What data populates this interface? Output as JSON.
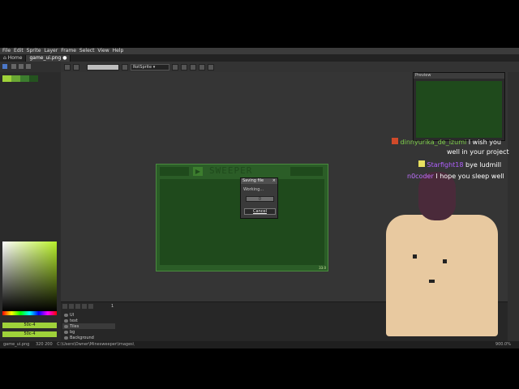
{
  "menu": [
    "File",
    "Edit",
    "Sprite",
    "Layer",
    "Frame",
    "Select",
    "View",
    "Help"
  ],
  "tabs": [
    {
      "label": "Home"
    },
    {
      "label": "game_ui.png",
      "active": true
    }
  ],
  "context_bar": {
    "mode_value": "RotSprite"
  },
  "preview": {
    "title": "Preview"
  },
  "sprite": {
    "title_text": "SWEEPER",
    "zoom_badge": "33.0"
  },
  "dialog": {
    "title": "Saving file",
    "status": "Working...",
    "progress_label": "0",
    "progress": 0,
    "cancel_label": "Cancel"
  },
  "color_fields": {
    "fg": "50c-4",
    "bg": "50c-4"
  },
  "layers": [
    {
      "name": "UI"
    },
    {
      "name": "text"
    },
    {
      "name": "Tiles"
    },
    {
      "name": "bg"
    },
    {
      "name": "Background"
    }
  ],
  "frame_number": "1",
  "status": {
    "file": "game_ui.png",
    "size": "320 200",
    "path": "C:\\Users\\Owner\\Minesweeper\\images\\",
    "zoom": "900.0%"
  },
  "chat": [
    {
      "user": "dinnyurika_de_izumi",
      "user_color": "#7fd14a",
      "message": "I wish you",
      "badge": "#d04a2a"
    },
    {
      "user": "",
      "user_color": "#ffffff",
      "message": "well in your project"
    },
    {
      "user": "Starfight18",
      "user_color": "#b060ff",
      "message": "bye ludmill",
      "badge": "#e8e060"
    },
    {
      "user": "n0coder",
      "user_color": "#c070ff",
      "message": "I hope you sleep well"
    }
  ],
  "colors": {
    "sprite_bg": "#2b5d27",
    "sprite_dark": "#1f4a1c",
    "accent": "#9fd23a"
  }
}
